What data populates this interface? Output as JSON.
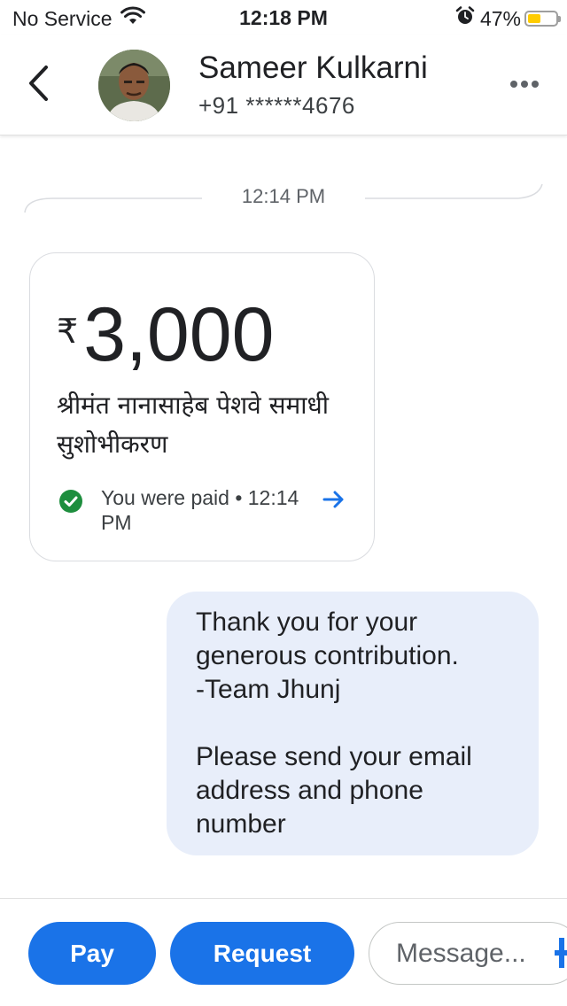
{
  "status_bar": {
    "carrier": "No Service",
    "time": "12:18 PM",
    "battery_percent": "47%",
    "battery_level": 0.47,
    "icons": [
      "wifi-icon",
      "alarm-icon",
      "battery-icon"
    ]
  },
  "header": {
    "contact_name": "Sameer Kulkarni",
    "contact_phone": "+91 ******4676",
    "icons": [
      "back-arrow-icon",
      "more-options-icon"
    ]
  },
  "conversation": {
    "timestamp": "12:14 PM",
    "payment": {
      "currency_symbol": "₹",
      "amount": "3,000",
      "note_line1": "श्रीमंत नानासाहेब पेशवे समाधी",
      "note_line2": "सुशोभीकरण",
      "status_text": "You were paid • 12:14 PM",
      "status_color": "#1e8e3e",
      "icons": [
        "check-circle-icon",
        "arrow-right-icon"
      ]
    },
    "sent_message": {
      "line1": "Thank you for your",
      "line2": "generous contribution.",
      "line3": "-Team Jhunj",
      "line4": "Please send your email",
      "line5": "address and phone",
      "line6": "number"
    }
  },
  "bottom_bar": {
    "pay_label": "Pay",
    "request_label": "Request",
    "message_placeholder": "Message...",
    "accent_color": "#1a73e8"
  }
}
